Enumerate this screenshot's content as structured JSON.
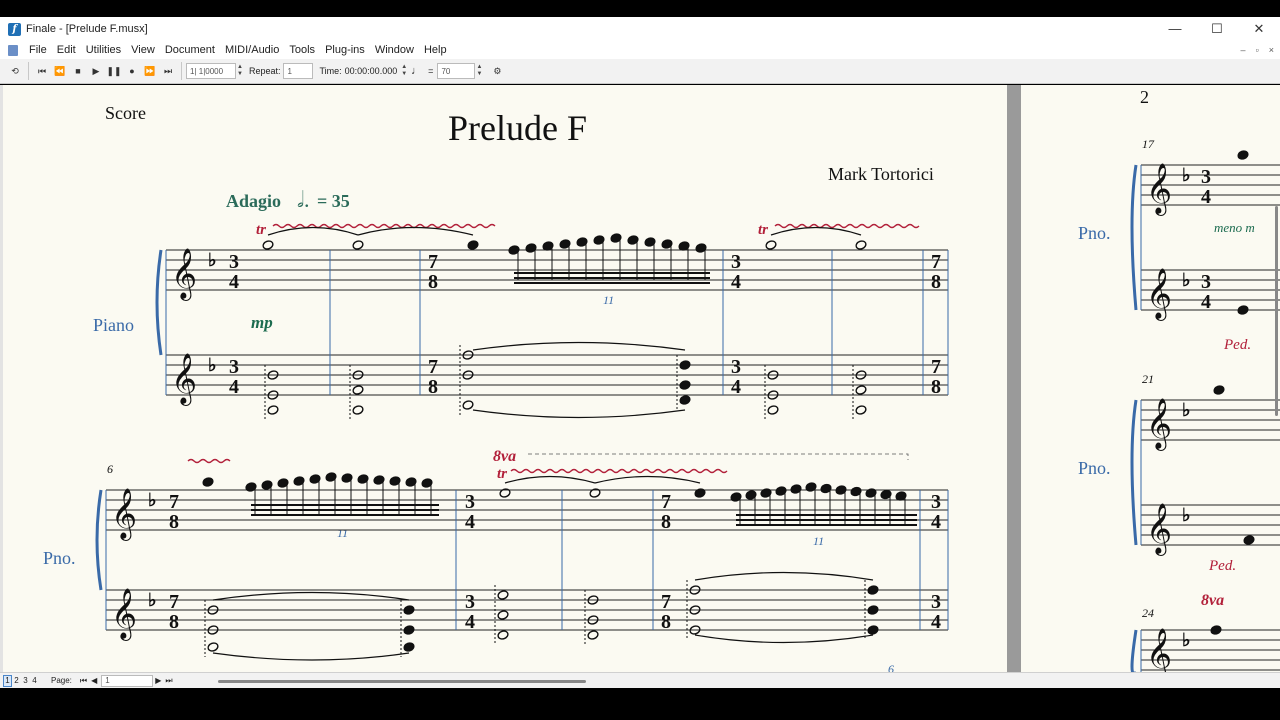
{
  "window": {
    "title": "Finale - [Prelude F.musx]",
    "minimize": "—",
    "maximize": "☐",
    "close": "✕"
  },
  "menu": [
    "File",
    "Edit",
    "Utilities",
    "View",
    "Document",
    "MIDI/Audio",
    "Tools",
    "Plug-ins",
    "Window",
    "Help"
  ],
  "mdi_controls": {
    "minimize": "–",
    "restore": "▫",
    "close": "×"
  },
  "toolbar": {
    "measure_counter": "1| 1|0000",
    "repeat_label": "Repeat:",
    "repeat_value": "1",
    "time_label": "Time:",
    "time_value": "00:00:00.000",
    "tempo_equals": "=",
    "tempo_value": "70"
  },
  "score": {
    "score_label": "Score",
    "title": "Prelude F",
    "composer": "Mark Tortorici",
    "tempo_text": "Adagio",
    "tempo_value": "= 35",
    "instrument_full": "Piano",
    "instrument_short": "Pno.",
    "dynamic": "mp",
    "trill": "tr",
    "octave": "8va",
    "tuplet": "11",
    "measure_6": "6",
    "measure_bottom": "6",
    "page2_number": "2",
    "measure_17": "17",
    "measure_21": "21",
    "measure_24": "24",
    "meno_text": "meno m",
    "pedal": "Ped.",
    "time_sig_34_top": "3",
    "time_sig_34_bottom": "4",
    "time_sig_78_top": "7",
    "time_sig_78_bottom": "8"
  },
  "status": {
    "page_tabs": [
      "1",
      "2",
      "3",
      "4"
    ],
    "page_label": "Page:",
    "page_value": "1"
  },
  "colors": {
    "trill": "#b2203a",
    "dynamic": "#1b6b4f",
    "instrument": "#3a6aa8",
    "paper": "#fbfaf2"
  }
}
